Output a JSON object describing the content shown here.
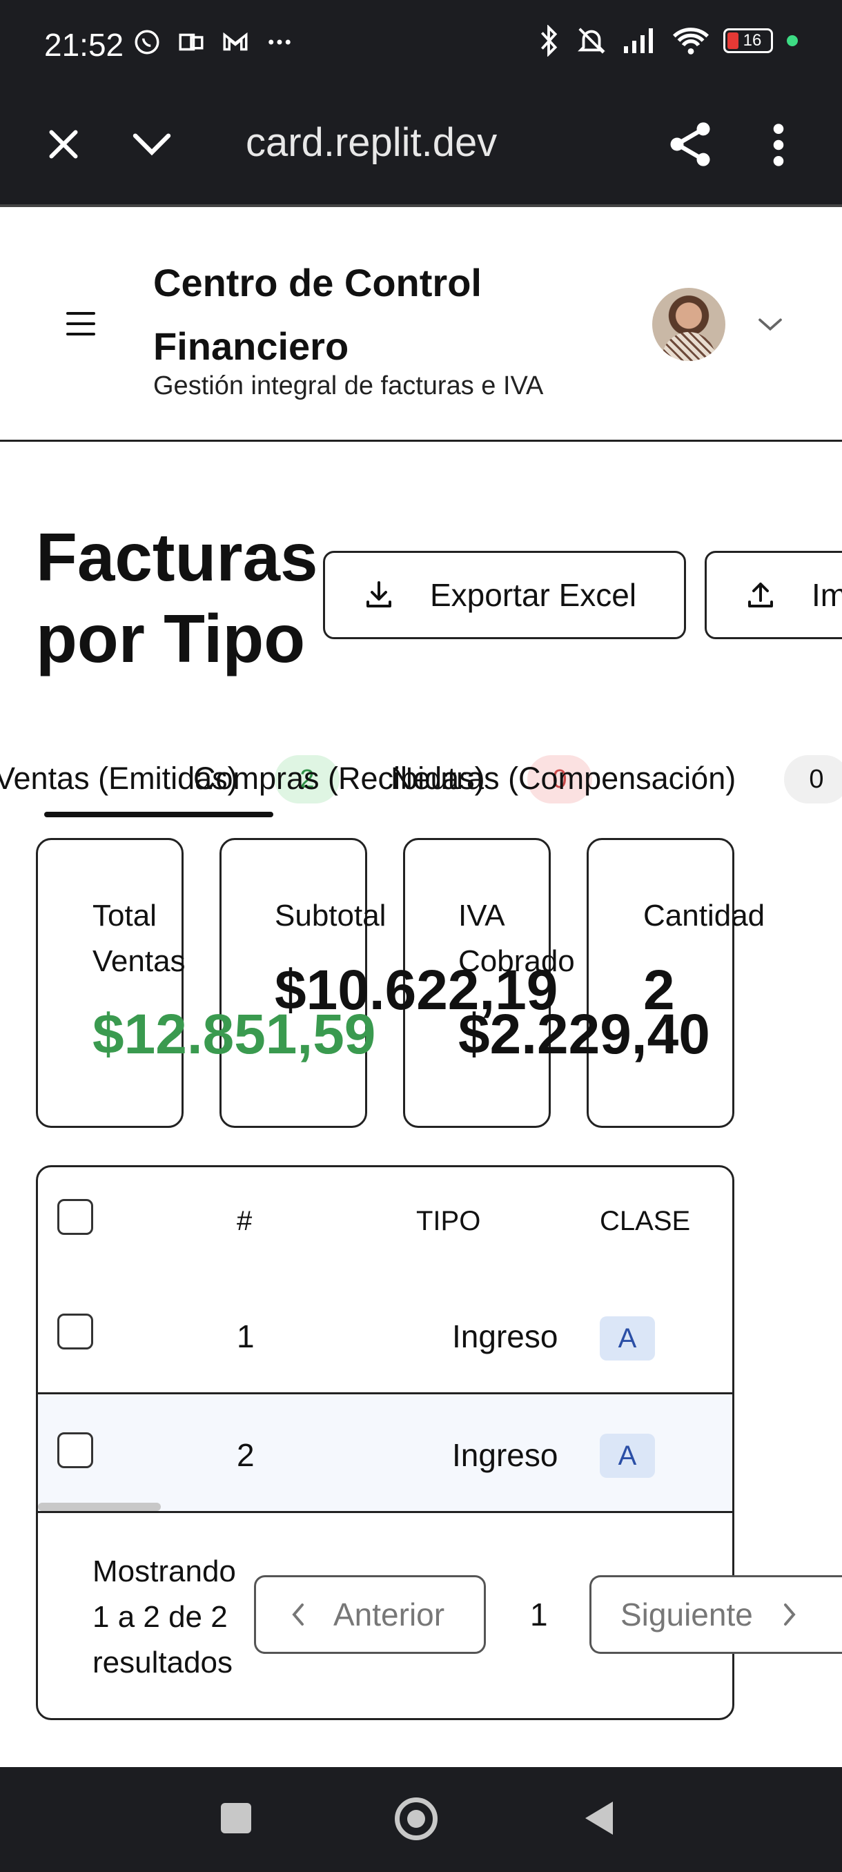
{
  "status_bar": {
    "time": "21:52",
    "battery": "16"
  },
  "browser": {
    "url": "card.replit.dev"
  },
  "app": {
    "title": "Centro de Control Financiero",
    "subtitle": "Gestión integral de facturas e IVA"
  },
  "page": {
    "title": "Facturas por Tipo",
    "export_label": "Exportar Excel",
    "import_label": "Im"
  },
  "tabs": [
    {
      "label": "Ventas (Emitidas)",
      "count": "2",
      "color": "#dff5e3",
      "text_color": "#2f8f46"
    },
    {
      "label": "Compras (Recibidas)",
      "count": "0",
      "color": "#fbe1e1",
      "text_color": "#c94a4a"
    },
    {
      "label": "Neutras (Compensación)",
      "count": "0",
      "color": "#f0f0f0",
      "text_color": "#111111"
    }
  ],
  "stats": [
    {
      "label": "Total Ventas",
      "value": "$12.851,59",
      "color": "#3a9a4f"
    },
    {
      "label": "Subtotal",
      "value": "$10.622,19",
      "color": "#111111"
    },
    {
      "label": "IVA Cobrado",
      "value": "$2.229,40",
      "color": "#111111"
    },
    {
      "label": "Cantidad",
      "value": "2",
      "color": "#111111"
    }
  ],
  "table": {
    "headers": [
      "#",
      "TIPO",
      "CLASE"
    ],
    "rows": [
      {
        "num": "1",
        "tipo": "Ingreso",
        "clase": "A"
      },
      {
        "num": "2",
        "tipo": "Ingreso",
        "clase": "A"
      }
    ]
  },
  "pagination": {
    "summary": "Mostrando 1 a 2 de 2 resultados",
    "prev_label": "Anterior",
    "page": "1",
    "next_label": "Siguiente"
  }
}
